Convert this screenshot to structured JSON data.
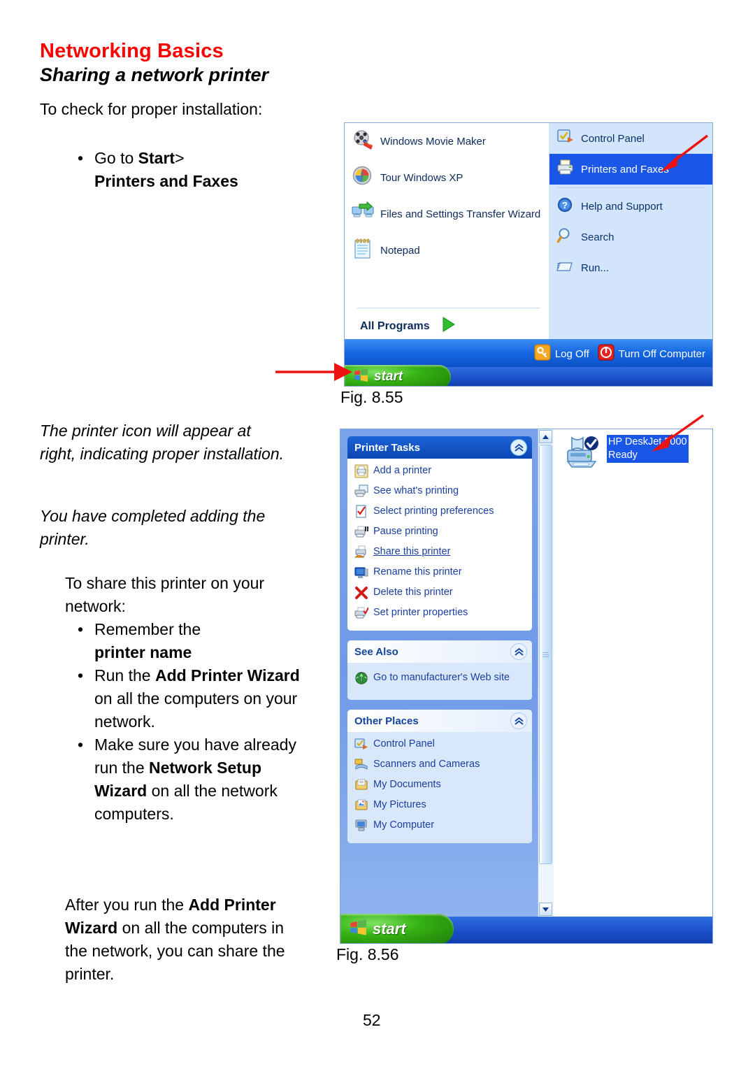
{
  "doc": {
    "section_title": "Networking Basics",
    "page_subtitle": "Sharing a network printer",
    "page_number": "52"
  },
  "left_column": {
    "intro": "To check for proper installation:",
    "bullets_1": [
      {
        "prefix": "Go to ",
        "bold": "Start",
        "suffix": ">"
      },
      {
        "prefix": "",
        "bold": "Printers and Faxes",
        "suffix": ""
      }
    ],
    "note_1": "The printer icon will appear at right, indicating proper installation.",
    "note_2": "You have completed adding the printer.",
    "share_intro": "To share this printer on your network:",
    "bullets_2": [
      {
        "line1": "Remember the",
        "bold1": "printer name"
      },
      {
        "pre": "Run the ",
        "bold": "Add Printer Wizard",
        "post": " on all the computers on your network."
      },
      {
        "pre": "Make sure you have already run the ",
        "bold": "Network Setup Wizard",
        "post": " on all the network computers."
      }
    ],
    "closing": {
      "pre": "After you run the ",
      "bold": "Add Printer Wizard",
      "post": " on all the computers in the network, you can share the printer."
    }
  },
  "fig55": {
    "caption": "Fig. 8.55",
    "left_items": [
      {
        "label": "Windows Movie Maker",
        "icon": "movie-maker-icon"
      },
      {
        "label": "Tour Windows XP",
        "icon": "tour-windows-icon"
      },
      {
        "label": "Files and Settings Transfer Wizard",
        "icon": "transfer-wizard-icon"
      },
      {
        "label": "Notepad",
        "icon": "notepad-icon"
      }
    ],
    "all_programs": "All Programs",
    "right_items": [
      {
        "label": "Control Panel",
        "icon": "control-panel-icon",
        "selected": false
      },
      {
        "label": "Printers and Faxes",
        "icon": "printer-icon",
        "selected": true
      },
      {
        "label": "Help and Support",
        "icon": "help-icon",
        "selected": false
      },
      {
        "label": "Search",
        "icon": "search-icon",
        "selected": false
      },
      {
        "label": "Run...",
        "icon": "run-icon",
        "selected": false
      }
    ],
    "log_off": "Log Off",
    "turn_off": "Turn Off Computer",
    "start_label": "start"
  },
  "fig56": {
    "caption": "Fig. 8.56",
    "printer_tasks": {
      "title": "Printer Tasks",
      "items": [
        {
          "label": "Add a printer",
          "icon": "add-printer-icon",
          "link": false
        },
        {
          "label": "See what's printing",
          "icon": "see-printing-icon",
          "link": false
        },
        {
          "label": "Select printing preferences",
          "icon": "printing-preferences-icon",
          "link": false
        },
        {
          "label": "Pause printing",
          "icon": "pause-printing-icon",
          "link": false
        },
        {
          "label": "Share this printer",
          "icon": "share-printer-icon",
          "link": true
        },
        {
          "label": "Rename this  printer",
          "icon": "rename-printer-icon",
          "link": false
        },
        {
          "label": "Delete this printer",
          "icon": "delete-printer-icon",
          "link": false
        },
        {
          "label": "Set printer properties",
          "icon": "printer-properties-icon",
          "link": false
        }
      ]
    },
    "see_also": {
      "title": "See Also",
      "items": [
        {
          "label": "Go to manufacturer's Web site",
          "icon": "globe-icon"
        }
      ]
    },
    "other_places": {
      "title": "Other Places",
      "items": [
        {
          "label": "Control Panel",
          "icon": "control-panel-icon"
        },
        {
          "label": "Scanners and Cameras",
          "icon": "scanner-icon"
        },
        {
          "label": "My Documents",
          "icon": "my-documents-icon"
        },
        {
          "label": "My Pictures",
          "icon": "my-pictures-icon"
        },
        {
          "label": "My Computer",
          "icon": "my-computer-icon"
        }
      ]
    },
    "printer": {
      "name": "HP DeskJet 5000",
      "status": "Ready",
      "icon": "printer-default-icon"
    },
    "start_label": "start",
    "collapse_glyph": "«"
  },
  "colors": {
    "heading_red": "#ff0000",
    "xp_select_blue": "#1a56e8",
    "nav_pane_blue": "#7aa2ea",
    "arrow_red": "#ee1111"
  }
}
